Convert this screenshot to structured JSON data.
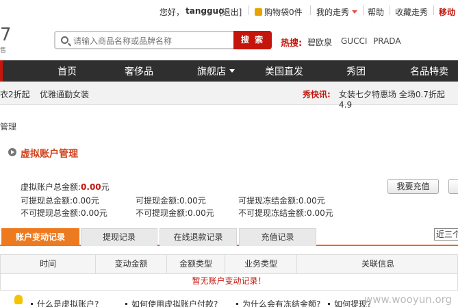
{
  "topbar": {
    "greeting": "您好，",
    "username": "tangguo",
    "logout": "[退出]",
    "cart": "购物袋0件",
    "my_show": "我的走秀",
    "help": "帮助",
    "favorite": "收藏走秀",
    "mobile": "移动"
  },
  "header": {
    "logo_fragment": "7",
    "logo_sub": "售",
    "search_placeholder": "请输入商品名称或品牌名称",
    "search_button": "搜 索",
    "hot_label": "热搜:",
    "hot_items": [
      "碧欧泉",
      "GUCCI",
      "PRADA"
    ]
  },
  "nav": {
    "items": [
      "首页",
      "奢侈品",
      "旗舰店",
      "美国直发",
      "秀团",
      "名品特卖"
    ]
  },
  "subbar": {
    "promo1": "衣2折起",
    "promo2": "优雅通勤女装",
    "flash_label": "秀快讯:",
    "flash_text": "女装七夕特惠场 全场0.7折起 4.9"
  },
  "breadcrumb": "管理",
  "page_title": "虚拟账户管理",
  "balance": {
    "total_label": "虚拟账户总金额:",
    "total_value": "0.00",
    "total_unit": "元",
    "withdrawable_total": "可提现总金额:0.00元",
    "withdrawable": "可提现金额:0.00元",
    "withdrawable_frozen": "可提现冻结金额:0.00元",
    "non_withdrawable_total": "不可提现总金额:0.00元",
    "non_withdrawable": "不可提现金额:0.00元",
    "non_withdrawable_frozen": "不可提现冻结金额:0.00元",
    "recharge_button": "我要充值"
  },
  "tabs": [
    "账户变动记录",
    "提现记录",
    "在线退款记录",
    "充值记录"
  ],
  "period_select": "近三个月",
  "table": {
    "headers": [
      "时间",
      "变动金额",
      "金额类型",
      "业务类型",
      "关联信息"
    ],
    "empty_message": "暂无账户变动记录！"
  },
  "faq": [
    "什么是虚拟账户?",
    "如何使用虚拟账户付款?",
    "为什么会有冻结金额?",
    "如何提现?"
  ],
  "watermark": "www.wooyun.org",
  "colors": {
    "brand_red": "#c4160d",
    "tab_orange": "#ee7a1f",
    "nav_dark": "#2f2f2f"
  }
}
